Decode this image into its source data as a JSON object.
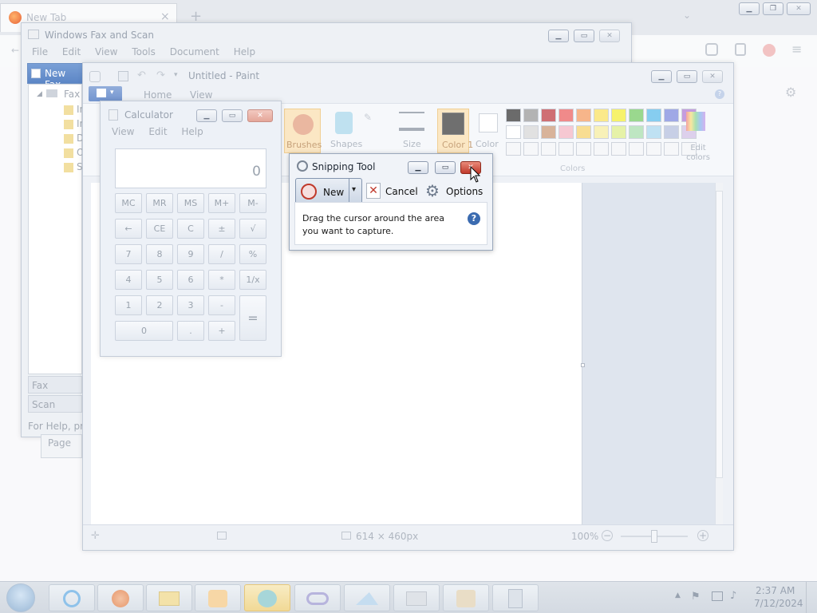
{
  "firefox": {
    "tab_title": "New Tab",
    "new_tab_symbol": "+",
    "close_symbol": "×"
  },
  "fax": {
    "title": "Windows Fax and Scan",
    "menu": [
      "File",
      "Edit",
      "View",
      "Tools",
      "Document",
      "Help"
    ],
    "new_fax": "New Fax",
    "tree_root": "Fax",
    "tree_children": [
      "In",
      "In",
      "D",
      "O",
      "S"
    ],
    "nav_fax": "Fax",
    "nav_scan": "Scan",
    "status": "For Help, pre",
    "page_label": "Page"
  },
  "paint": {
    "title": "Untitled - Paint",
    "tabs": [
      "Home",
      "View"
    ],
    "tools": {
      "brushes": "Brushes",
      "shapes": "Shapes",
      "size": "Size",
      "color1": "Color 1",
      "color2": "Color",
      "edit_colors": "Edit colors",
      "colors_group": "Colors"
    },
    "palette_row1": [
      "#6b6b6b",
      "#b3b3b3",
      "#cf6f74",
      "#f08a8a",
      "#f7b58a",
      "#fbe98a",
      "#f6f26c",
      "#9ad88e",
      "#86cdf0",
      "#9fa8e6",
      "#c59cde"
    ],
    "palette_row2": [
      "#ffffff",
      "#e1e1e1",
      "#d8b39a",
      "#f6c8d2",
      "#f8dd92",
      "#f8f1b8",
      "#e6f2a8",
      "#bee6c2",
      "#bfe1f3",
      "#c7cfe6",
      "#ddd0ec"
    ],
    "status": {
      "size": "614 × 460px",
      "zoom": "100%"
    }
  },
  "calculator": {
    "title": "Calculator",
    "menu": [
      "View",
      "Edit",
      "Help"
    ],
    "display": "0",
    "memory_row": [
      "MC",
      "MR",
      "MS",
      "M+",
      "M-"
    ],
    "row2": [
      "←",
      "CE",
      "C",
      "±",
      "√"
    ],
    "row3": [
      "7",
      "8",
      "9",
      "/",
      "%"
    ],
    "row4": [
      "4",
      "5",
      "6",
      "*",
      "1/x"
    ],
    "row5": [
      "1",
      "2",
      "3",
      "-"
    ],
    "row6": [
      "0",
      ".",
      "+"
    ],
    "equals": "="
  },
  "snipping": {
    "title": "Snipping Tool",
    "new_label": "New",
    "cancel_label": "Cancel",
    "options_label": "Options",
    "instruction": "Drag the cursor around the area you want to capture."
  },
  "taskbar": {
    "time": "2:37 AM",
    "date": "7/12/2024"
  },
  "colors": {
    "accent": "#3b6bb0",
    "close_red": "#d9513d"
  }
}
